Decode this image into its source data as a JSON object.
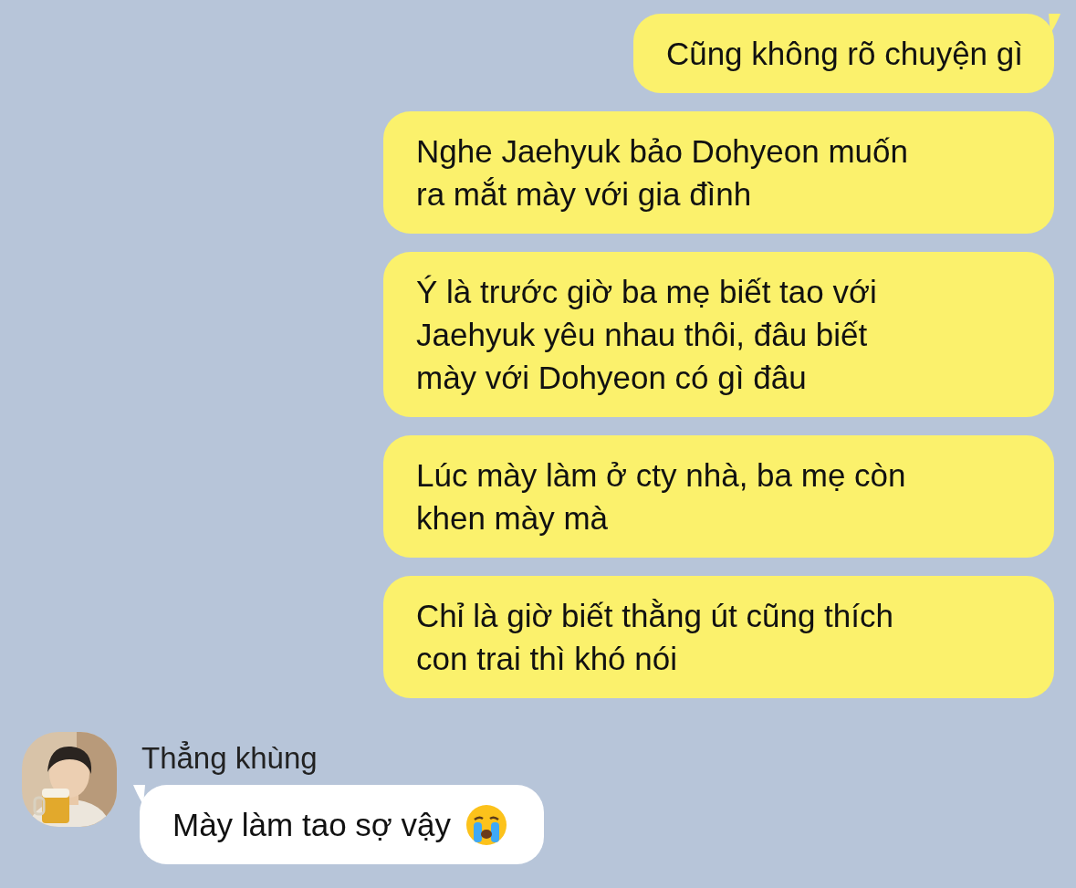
{
  "messages": [
    {
      "kind": "sent",
      "tail": true,
      "text": "Cũng không rõ chuyện gì"
    },
    {
      "kind": "sent",
      "tail": false,
      "text": "Nghe Jaehyuk bảo Dohyeon muốn\nra mắt mày với gia đình"
    },
    {
      "kind": "sent",
      "tail": false,
      "text": "Ý là trước giờ ba mẹ biết tao với\nJaehyuk yêu nhau thôi, đâu biết\nmày với Dohyeon có gì đâu"
    },
    {
      "kind": "sent",
      "tail": false,
      "text": "Lúc mày làm ở cty nhà, ba mẹ còn\nkhen mày mà"
    },
    {
      "kind": "sent",
      "tail": false,
      "text": "Chỉ là giờ biết thằng út cũng thích\ncon trai thì khó nói"
    },
    {
      "kind": "received",
      "tail": true,
      "sender": "Thẳng khùng",
      "text": "Mày làm tao sợ vậy"
    }
  ]
}
